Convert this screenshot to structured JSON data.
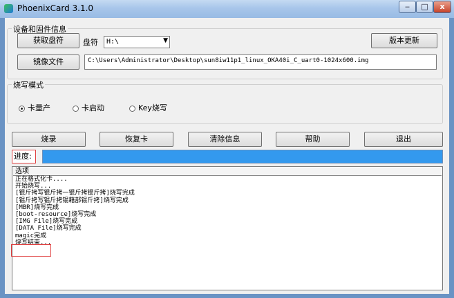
{
  "window": {
    "title": "PhoenixCard 3.1.0",
    "minimize": "‒",
    "maximize": "□",
    "close": "x"
  },
  "device_group": {
    "legend": "设备和固件信息",
    "get_drive_button": "获取盘符",
    "drive_label": "盘符",
    "drive_value": "H:\\",
    "update_button": "版本更新",
    "image_button": "镜像文件",
    "image_path": "C:\\Users\\Administrator\\Desktop\\sun8iw11p1_linux_OKA40i_C_uart0-1024x600.img"
  },
  "mode_group": {
    "legend": "烧写模式",
    "options": [
      {
        "label": "卡量产",
        "selected": true
      },
      {
        "label": "卡启动",
        "selected": false
      },
      {
        "label": "Key烧写",
        "selected": false
      }
    ]
  },
  "actions": {
    "burn": "烧录",
    "restore": "恢复卡",
    "clear": "清除信息",
    "help": "帮助",
    "exit": "退出"
  },
  "progress": {
    "label": "进度:",
    "fraction": 1.0,
    "color": "#3399ee"
  },
  "log": {
    "header": "选项",
    "lines": [
      "正在格式化卡....",
      "开始烧写...",
      "[锟斤拷写锟斤拷一锟斤拷锟斤拷]烧写完成",
      "[锟斤拷写锟斤拷锟藉部锟斤拷]烧写完成",
      "[MBR]烧写完成",
      "[boot-resource]烧写完成",
      "[IMG File]烧写完成",
      "[DATA File]烧写完成",
      "magic完成",
      "烧写结束..."
    ]
  }
}
